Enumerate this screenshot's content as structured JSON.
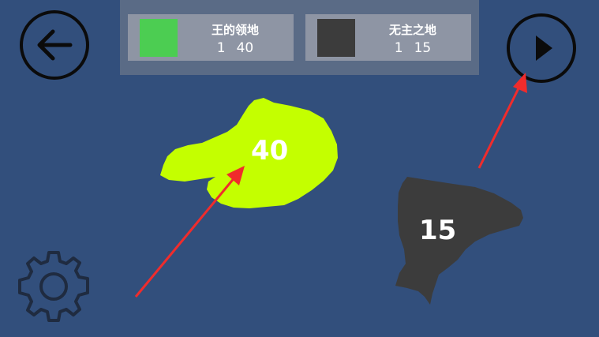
{
  "header": {
    "player_territory": {
      "name": "王的领地",
      "count": "1",
      "troops": "40",
      "color": "#4ccd52"
    },
    "neutral_territory": {
      "name": "无主之地",
      "count": "1",
      "troops": "15",
      "color": "#3c3c3c"
    }
  },
  "map": {
    "territories": [
      {
        "label": "40",
        "color": "#c4ff00",
        "owner": "player"
      },
      {
        "label": "15",
        "color": "#3c3c3c",
        "owner": "neutral"
      }
    ]
  },
  "controls": {
    "back_icon": "arrow-left-icon",
    "next_icon": "play-triangle-icon",
    "settings_icon": "gear-icon"
  },
  "annotations": {
    "arrow_color": "#f02c2c"
  },
  "colors": {
    "background": "#324f7c",
    "panel": "#5a6b86",
    "card": "#8e95a4"
  }
}
